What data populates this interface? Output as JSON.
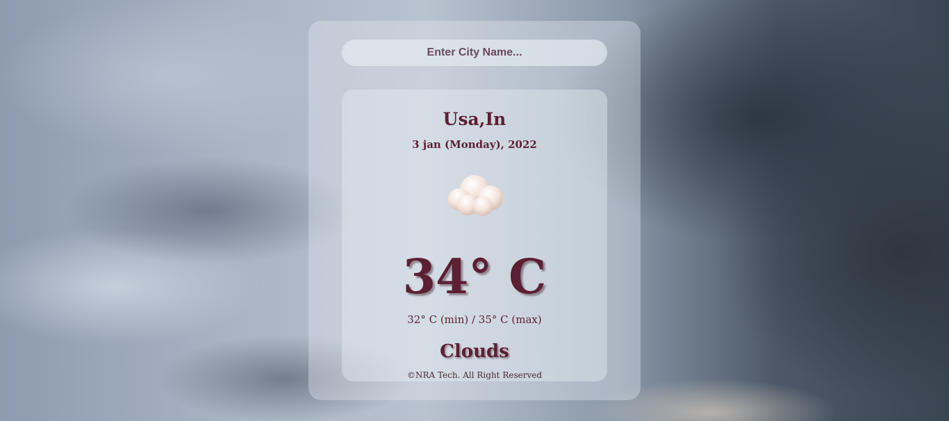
{
  "search": {
    "placeholder": "Enter City Name..."
  },
  "weather": {
    "city": "Usa,In",
    "date": "3 jan (Monday), 2022",
    "icon": "cloud-icon",
    "temperature": "34° C",
    "min_max": "32° C (min) / 35° C (max)",
    "condition": "Clouds"
  },
  "footer": {
    "text": "©NRA Tech. All Right Reserved"
  },
  "colors": {
    "text_primary": "#5d1f33",
    "placeholder": "#6b4a5c"
  }
}
